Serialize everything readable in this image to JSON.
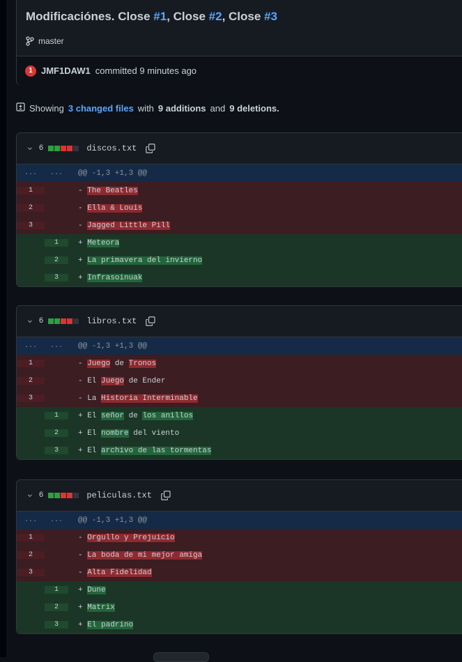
{
  "commit": {
    "title_prefix": "Modificaciónes. Close ",
    "refs": [
      "#1",
      "#2",
      "#3"
    ],
    "sep": ", Close ",
    "branch": "master",
    "author_badge": "1",
    "author": "JMF1DAW1",
    "committed_text": "committed 9 minutes ago"
  },
  "summary": {
    "showing": "Showing",
    "changed_files": "3 changed files",
    "with": "with",
    "additions": "9 additions",
    "and": "and",
    "deletions": "9 deletions."
  },
  "colors": {
    "added": "#2ea043",
    "deleted": "#da3633",
    "neutral": "#30363d",
    "link": "#58a6ff"
  },
  "files": [
    {
      "count": "6",
      "name": "discos.txt",
      "hunk": "@@ -1,3 +1,3 @@",
      "dots": "...",
      "deleted": [
        "The Beatles",
        "Ella & Louis",
        "Jagged Little Pill"
      ],
      "added": [
        "Meteora",
        "La primavera del invierno",
        "Infrasoinuak"
      ]
    },
    {
      "count": "6",
      "name": "libros.txt",
      "hunk": "@@ -1,3 +1,3 @@",
      "dots": "...",
      "deleted": [
        "Juego de Tronos",
        "El Juego de Ender",
        "La Historia Interminable"
      ],
      "added": [
        "El señor de los anillos",
        "El nombre del viento",
        "El archivo de las tormentas"
      ]
    },
    {
      "count": "6",
      "name": "peliculas.txt",
      "hunk": "@@ -1,3 +1,3 @@",
      "dots": "...",
      "deleted": [
        "Orgullo y Prejuicio",
        "La boda de mi mejor amiga",
        "Alta Fidelidad"
      ],
      "added": [
        "Dune",
        "Matrix",
        "El padrino"
      ]
    }
  ]
}
